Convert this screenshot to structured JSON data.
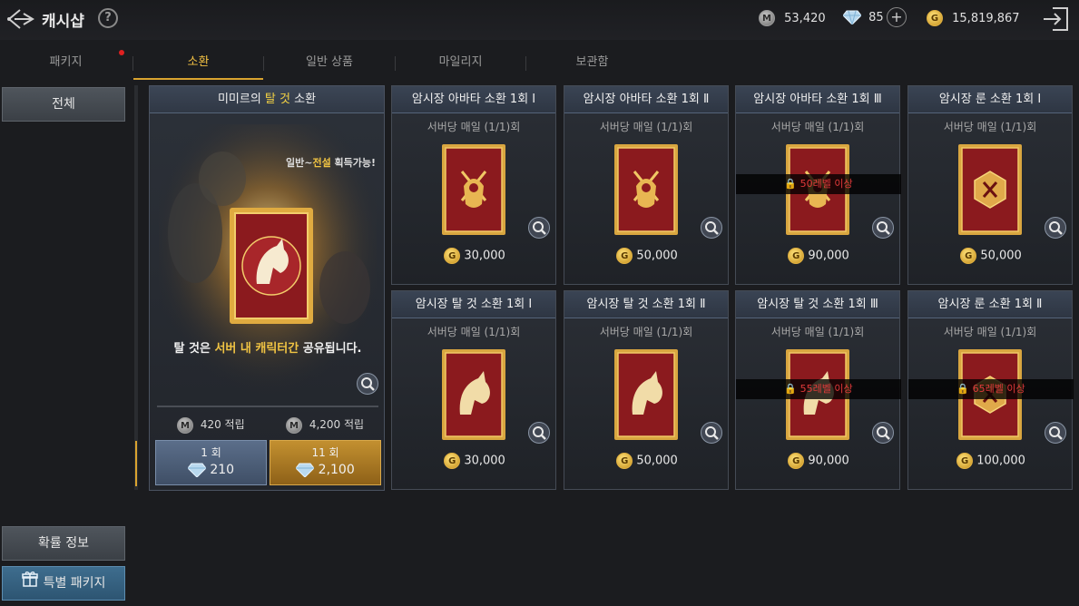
{
  "header": {
    "title": "캐시샵",
    "help": "?",
    "mileage_coin": "M",
    "mileage": "53,420",
    "diamonds": "85",
    "plus": "+",
    "gold_coin": "G",
    "gold": "15,819,867"
  },
  "tabs": [
    {
      "label": "패키지",
      "new": true
    },
    {
      "label": "소환",
      "active": true
    },
    {
      "label": "일반 상품"
    },
    {
      "label": "마일리지"
    },
    {
      "label": "보관함"
    }
  ],
  "sidebar": {
    "all_label": "전체",
    "prob_label": "확률 정보",
    "special_label": "특별 패키지"
  },
  "featured": {
    "title_pre": "미미르의 ",
    "title_hl": "탈 것",
    "title_post": " 소환",
    "tag_pre": "일반~",
    "tag_hl": "전설",
    "tag_post": " 획득가능!",
    "desc_pre": "탈 것은 ",
    "desc_hl": "서버 내 캐릭터간",
    "desc_post": " 공유됩니다.",
    "mileage_1": "420 적립",
    "mileage_11": "4,200 적립",
    "coin_label": "M",
    "buy_1_count": "1 회",
    "buy_1_price": "210",
    "buy_11_count": "11 회",
    "buy_11_price": "2,100"
  },
  "cards": [
    {
      "title": "암시장 아바타 소환 1회 Ⅰ",
      "sub": "서버당 매일 (1/1)회",
      "price": "30,000",
      "art": "avatar",
      "lock": ""
    },
    {
      "title": "암시장 아바타 소환 1회 Ⅱ",
      "sub": "서버당 매일 (1/1)회",
      "price": "50,000",
      "art": "avatar",
      "lock": ""
    },
    {
      "title": "암시장 아바타 소환 1회 Ⅲ",
      "sub": "서버당 매일 (1/1)회",
      "price": "90,000",
      "art": "avatar",
      "lock": "50레벨 이상"
    },
    {
      "title": "암시장 룬 소환 1회 Ⅰ",
      "sub": "서버당 매일 (1/1)회",
      "price": "50,000",
      "art": "rune",
      "lock": ""
    },
    {
      "title": "암시장 탈 것 소환 1회 Ⅰ",
      "sub": "서버당 매일 (1/1)회",
      "price": "30,000",
      "art": "horse",
      "lock": ""
    },
    {
      "title": "암시장 탈 것 소환 1회 Ⅱ",
      "sub": "서버당 매일 (1/1)회",
      "price": "50,000",
      "art": "horse",
      "lock": ""
    },
    {
      "title": "암시장 탈 것 소환 1회 Ⅲ",
      "sub": "서버당 매일 (1/1)회",
      "price": "90,000",
      "art": "horse",
      "lock": "55레벨 이상"
    },
    {
      "title": "암시장 룬 소환 1회 Ⅱ",
      "sub": "서버당 매일 (1/1)회",
      "price": "100,000",
      "art": "rune",
      "lock": "65레벨 이상"
    }
  ],
  "coin_gold": "G",
  "colors": {
    "accent_gold": "#d9a32f",
    "highlight_yellow": "#f1c443",
    "lock_red": "#e23a3a",
    "card_red": "#8b1a1e"
  }
}
